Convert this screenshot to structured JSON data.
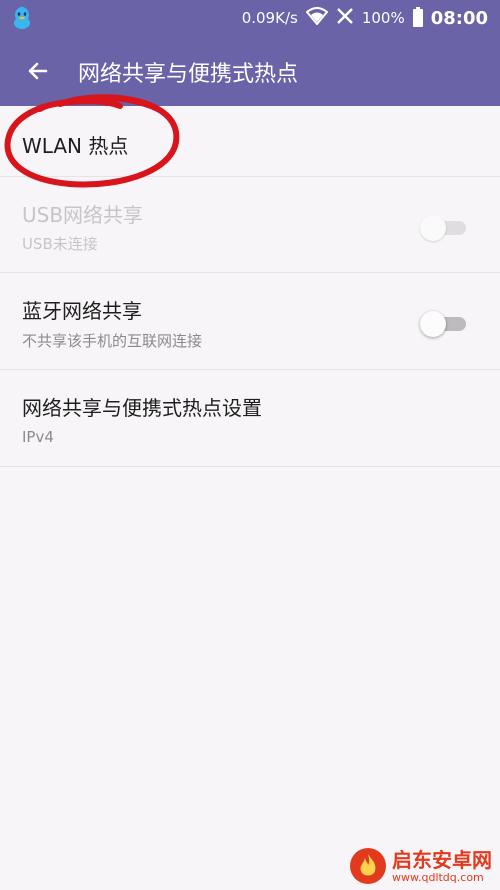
{
  "status_bar": {
    "app_icon": "qq-penguin-icon",
    "speed": "0.09K/s",
    "wifi_icon": "wifi-icon",
    "no_signal_icon": "no-signal-icon",
    "battery_percent": "100%",
    "time": "08:00"
  },
  "toolbar": {
    "back_icon": "arrow-left-icon",
    "title": "网络共享与便携式热点"
  },
  "items": [
    {
      "title": "WLAN 热点",
      "subtitle": ""
    },
    {
      "title": "USB网络共享",
      "subtitle": "USB未连接",
      "toggle_on": false,
      "enabled": false
    },
    {
      "title": "蓝牙网络共享",
      "subtitle": "不共享该手机的互联网连接",
      "toggle_on": false,
      "enabled": true
    },
    {
      "title": "网络共享与便携式热点设置",
      "subtitle": "IPv4"
    }
  ],
  "annotation": {
    "color": "#d8141c"
  },
  "watermark": {
    "logo": "flame-logo-icon",
    "name": "启东安卓网",
    "url": "www.qdltdq.com"
  },
  "colors": {
    "header": "#6a63a8",
    "background": "#f7f5f7"
  }
}
